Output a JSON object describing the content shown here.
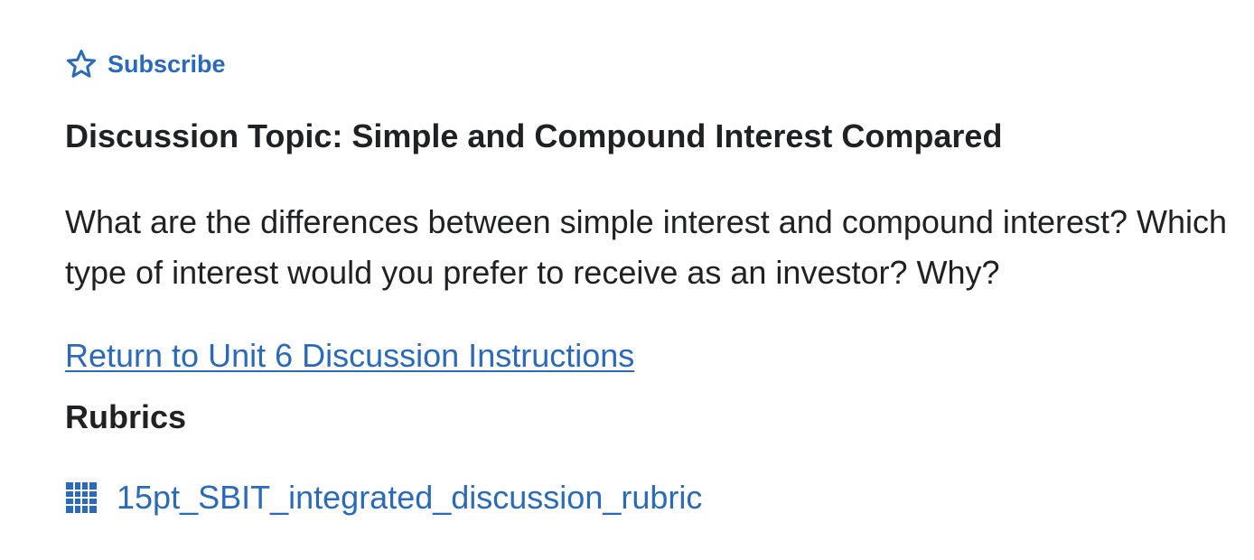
{
  "subscribe": {
    "label": "Subscribe",
    "icon": "star-outline-icon"
  },
  "topic": {
    "title": "Discussion Topic: Simple and Compound Interest Compared",
    "body": "What are the differences between simple interest and compound interest? Which type of interest would you prefer to receive as an investor? Why?"
  },
  "return_link": {
    "label": "Return to Unit 6 Discussion Instructions"
  },
  "rubrics": {
    "heading": "Rubrics",
    "items": [
      {
        "label": "15pt_SBIT_integrated_discussion_rubric",
        "icon": "grid-table-icon"
      }
    ]
  },
  "colors": {
    "link": "#2a6ab8",
    "text": "#202122",
    "background": "#ffffff"
  }
}
